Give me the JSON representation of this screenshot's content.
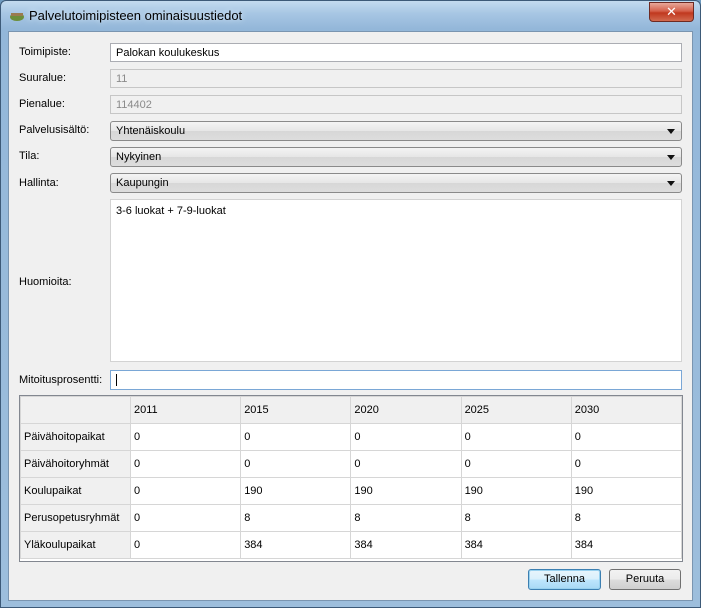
{
  "window": {
    "title": "Palvelutoimipisteen ominaisuustiedot",
    "close_label": "✕"
  },
  "form": {
    "toimipiste": {
      "label": "Toimipiste:",
      "value": "Palokan koulukeskus"
    },
    "suuralue": {
      "label": "Suuralue:",
      "value": "11"
    },
    "pienalue": {
      "label": "Pienalue:",
      "value": "114402"
    },
    "palvelusisalto": {
      "label": "Palvelusisältö:",
      "value": "Yhtenäiskoulu"
    },
    "tila": {
      "label": "Tila:",
      "value": "Nykyinen"
    },
    "hallinta": {
      "label": "Hallinta:",
      "value": "Kaupungin"
    },
    "huomioita": {
      "label": "Huomioita:",
      "value": "3-6 luokat + 7-9-luokat"
    },
    "mitoitus": {
      "label": "Mitoitusprosentti:",
      "value": ""
    }
  },
  "table": {
    "columns": [
      "2011",
      "2015",
      "2020",
      "2025",
      "2030"
    ],
    "rows": [
      {
        "label": "Päivähoitopaikat",
        "cells": [
          "0",
          "0",
          "0",
          "0",
          "0"
        ]
      },
      {
        "label": "Päivähoitoryhmät",
        "cells": [
          "0",
          "0",
          "0",
          "0",
          "0"
        ]
      },
      {
        "label": "Koulupaikat",
        "cells": [
          "0",
          "190",
          "190",
          "190",
          "190"
        ]
      },
      {
        "label": "Perusopetusryhmät",
        "cells": [
          "0",
          "8",
          "8",
          "8",
          "8"
        ]
      },
      {
        "label": "Yläkoulupaikat",
        "cells": [
          "0",
          "384",
          "384",
          "384",
          "384"
        ]
      }
    ]
  },
  "buttons": {
    "save": "Tallenna",
    "cancel": "Peruuta"
  }
}
